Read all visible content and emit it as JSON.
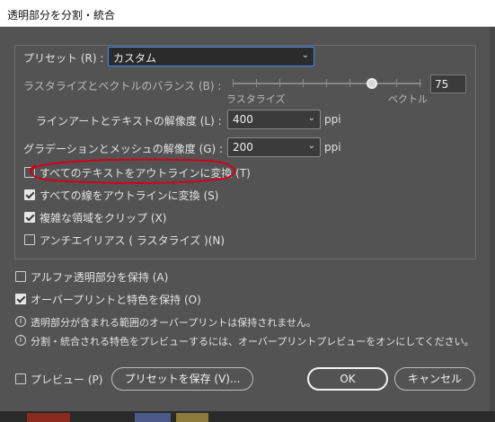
{
  "window": {
    "title": "透明部分を分割・統合"
  },
  "preset": {
    "label": "プリセット (R) :",
    "value": "カスタム"
  },
  "balance": {
    "label": "ラスタライズとベクトルのバランス (B) :",
    "left_label": "ラスタライズ",
    "right_label": "ベクトル",
    "value": "75",
    "level_percent": 75
  },
  "line_art_resolution": {
    "label": "ラインアートとテキストの解像度 (L) :",
    "value": "400",
    "unit": "ppi"
  },
  "gradient_resolution": {
    "label": "グラデーションとメッシュの解像度 (G) :",
    "value": "200",
    "unit": "ppi"
  },
  "options": [
    {
      "label": "すべてのテキストをアウトラインに変換 (T)",
      "checked": false
    },
    {
      "label": "すべての線をアウトラインに変換 (S)",
      "checked": true
    },
    {
      "label": "複雑な領域をクリップ (X)",
      "checked": true
    },
    {
      "label": "アンチエイリアス ( ラスタライズ )(N)",
      "checked": false
    }
  ],
  "alpha": {
    "label": "アルファ透明部分を保持 (A)",
    "checked": false
  },
  "overprint": {
    "label": "オーバープリントと特色を保持 (O)",
    "checked": true
  },
  "info": [
    "透明部分が含まれる範囲のオーバープリントは保持されません。",
    "分割・統合される特色をプレビューするには、オーバープリントプレビューをオンにしてください。"
  ],
  "preview": {
    "label": "プレビュー (P)",
    "checked": false
  },
  "buttons": {
    "save_preset": "プリセットを保存 (V)...",
    "ok": "OK",
    "cancel": "キャンセル"
  },
  "colors": {
    "dialog_bg": "#535353",
    "annotation": "#d0021b",
    "focus": "#3d8af7"
  }
}
